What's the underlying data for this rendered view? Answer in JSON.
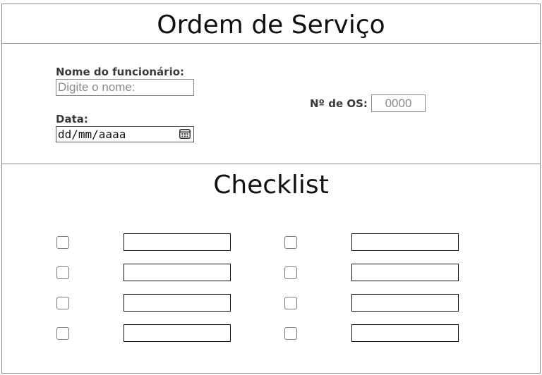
{
  "header": {
    "title": "Ordem de Serviço"
  },
  "form": {
    "employee_label": "Nome do funcionário:",
    "employee_placeholder": "Digite o nome:",
    "employee_value": "",
    "date_label": "Data:",
    "date_placeholder": "dd/mm/aaaa",
    "os_label": "Nº de OS:",
    "os_placeholder": "0000",
    "os_value": ""
  },
  "checklist": {
    "title": "Checklist",
    "items": [
      {
        "checked": false,
        "text": ""
      },
      {
        "checked": false,
        "text": ""
      },
      {
        "checked": false,
        "text": ""
      },
      {
        "checked": false,
        "text": ""
      },
      {
        "checked": false,
        "text": ""
      },
      {
        "checked": false,
        "text": ""
      },
      {
        "checked": false,
        "text": ""
      },
      {
        "checked": false,
        "text": ""
      }
    ]
  },
  "icons": {
    "date_picker": "calendar-icon"
  }
}
